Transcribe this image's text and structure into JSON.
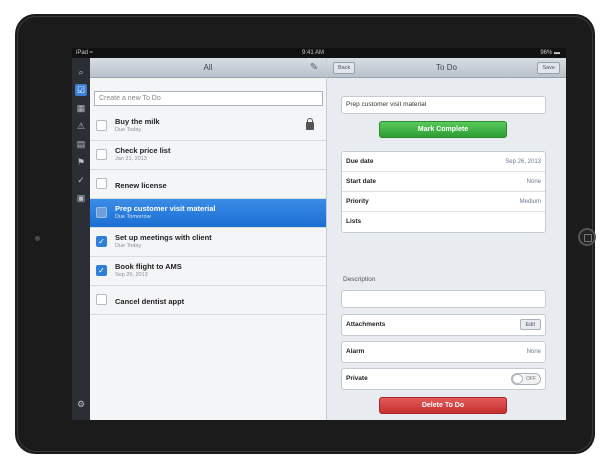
{
  "statusbar": {
    "carrier": "iPad ≈",
    "time": "9:41 AM",
    "battery": "96% ▬"
  },
  "sidebar": {
    "icons": [
      "search-icon",
      "checklist-icon",
      "calendar-icon",
      "alert-icon",
      "calendar-grid-icon",
      "flag-icon",
      "done-icon",
      "archive-icon",
      "settings-icon"
    ]
  },
  "list": {
    "title": "All",
    "compose_glyph": "✎",
    "new_todo_placeholder": "Create a new To Do",
    "items": [
      {
        "title": "Buy the milk",
        "subtitle": "Due Today",
        "checked": false,
        "locked": true
      },
      {
        "title": "Check price list",
        "subtitle": "Jan 31, 2013",
        "checked": false
      },
      {
        "title": "Renew license",
        "subtitle": "",
        "checked": false
      },
      {
        "title": "Prep customer visit material",
        "subtitle": "Due Tomorrow",
        "checked": false,
        "selected": true
      },
      {
        "title": "Set up meetings with client",
        "subtitle": "Due Today",
        "checked": true
      },
      {
        "title": "Book flight to AMS",
        "subtitle": "Sep 26, 2013",
        "checked": true
      },
      {
        "title": "Cancel dentist appt",
        "subtitle": "",
        "checked": false
      }
    ]
  },
  "detail": {
    "back_label": "Back",
    "title": "To Do",
    "save_label": "Save",
    "name_value": "Prep customer visit material",
    "complete_label": "Mark Complete",
    "fields": [
      {
        "label": "Due date",
        "value": "Sep 26, 2013"
      },
      {
        "label": "Start date",
        "value": "None"
      },
      {
        "label": "Priority",
        "value": "Medium"
      },
      {
        "label": "Lists",
        "value": ""
      }
    ],
    "description_label": "Description",
    "attachments_label": "Attachments",
    "edit_label": "Edit",
    "alarm_label": "Alarm",
    "alarm_value": "None",
    "private_label": "Private",
    "private_toggle": "OFF",
    "delete_label": "Delete To Do"
  },
  "colors": {
    "accent": "#1b6fd2",
    "complete": "#2e9e33",
    "delete": "#c42f2f"
  }
}
